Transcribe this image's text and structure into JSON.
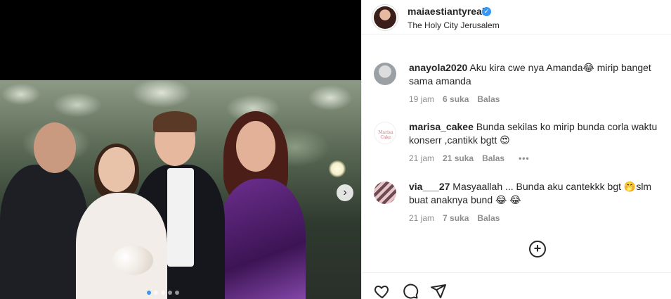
{
  "post": {
    "username": "maiaestiantyreal",
    "location": "The Holy City Jerusalem",
    "carousel": {
      "slide_count": 5,
      "active_index": 0
    }
  },
  "comments": [
    {
      "username": "anayola2020",
      "text": "Aku kira cwe nya Amanda😂 mirip banget sama amanda",
      "time": "19 jam",
      "likes": "6 suka",
      "reply": "Balas"
    },
    {
      "username": "marisa_cakee",
      "avatar_text": "Marisa Cake",
      "text": "Bunda sekilas ko mirip bunda corla waktu konserr ,cantikk bgtt 😍",
      "time": "21 jam",
      "likes": "21 suka",
      "reply": "Balas",
      "more": "•••"
    },
    {
      "username": "via___27",
      "text": "Masyaallah ... Bunda aku cantekkk bgt 🤭slm buat anaknya bund 😂 😂",
      "time": "21 jam",
      "likes": "7 suka",
      "reply": "Balas"
    }
  ],
  "icons": {
    "verified": "verified-badge-icon",
    "next": "chevron-right-icon",
    "add": "plus-circle-icon",
    "like": "heart-icon",
    "comment": "comment-icon",
    "share": "share-icon"
  },
  "colors": {
    "verified": "#3897f0",
    "muted": "#8e8e8e",
    "text": "#262626"
  }
}
